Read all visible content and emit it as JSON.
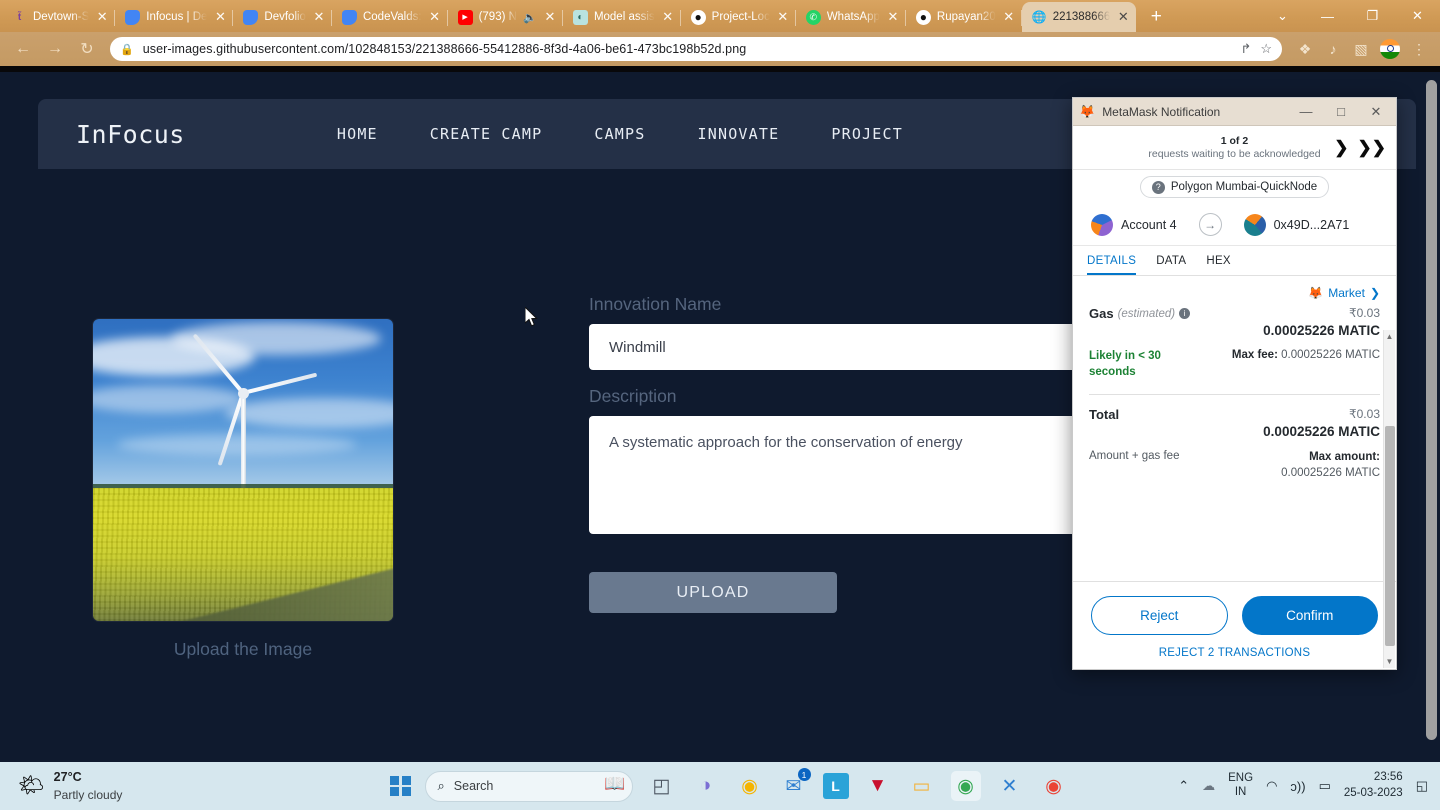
{
  "browser": {
    "tabs": [
      {
        "label": "Devtown-S",
        "icon": "todoist-icon",
        "active": false
      },
      {
        "label": "Infocus | De",
        "icon": "blue-doc-icon",
        "active": false
      },
      {
        "label": "Devfolio",
        "icon": "blue-doc-icon",
        "active": false
      },
      {
        "label": "CodeValds:",
        "icon": "blue-doc-icon",
        "active": false
      },
      {
        "label": "(793) N",
        "icon": "youtube-icon",
        "active": false,
        "muted": true
      },
      {
        "label": "Model assis",
        "icon": "spiral-icon",
        "active": false
      },
      {
        "label": "Project-Loc",
        "icon": "github-icon",
        "active": false
      },
      {
        "label": "WhatsApp",
        "icon": "whatsapp-icon",
        "active": false
      },
      {
        "label": "Rupayan20",
        "icon": "github-icon",
        "active": false
      },
      {
        "label": "221388666",
        "icon": "globe-icon",
        "active": true
      }
    ],
    "new_tab_label": "+",
    "tab_close_label": "✕",
    "window_controls": {
      "list": "⌄",
      "minimize": "—",
      "maximize": "❐",
      "close": "✕"
    },
    "toolbar": {
      "back": "←",
      "forward": "→",
      "reload": "↻",
      "lock_icon": "lock-icon",
      "url": "user-images.githubusercontent.com/102848153/221388666-55412886-8f3d-4a06-be61-473bc198b52d.png",
      "share_icon": "↱",
      "bookmark_icon": "☆",
      "extensions_icon": "❖",
      "reading_list_icon": "♪",
      "side_panel_icon": "▧",
      "profile_icon": "profile-avatar-india",
      "menu_icon": "⋮"
    }
  },
  "site": {
    "brand": "InFocus",
    "nav": [
      "HOME",
      "CREATE CAMP",
      "CAMPS",
      "INNOVATE",
      "PROJECT"
    ],
    "image_caption": "Upload the Image",
    "form": {
      "name_label": "Innovation Name",
      "name_value": "Windmill",
      "description_label": "Description",
      "description_value": "A systematic approach for the conservation of energy",
      "upload_button": "UPLOAD"
    }
  },
  "metamask": {
    "window_title": "MetaMask Notification",
    "titlebar": {
      "minimize": "—",
      "maximize": "□",
      "close": "✕"
    },
    "requests_count": "1 of 2",
    "requests_text": "requests waiting to be acknowledged",
    "next_arrow": "❯",
    "last_arrow": "❯❯",
    "network": "Polygon Mumbai-QuickNode",
    "network_help": "?",
    "from_account": "Account 4",
    "to_account": "0x49D...2A71",
    "transfer_arrow": "→",
    "tabs": [
      "DETAILS",
      "DATA",
      "HEX"
    ],
    "active_tab": "DETAILS",
    "market_label": "Market",
    "market_chevron": "❯",
    "gas_label": "Gas",
    "gas_estimated": "(estimated)",
    "gas_info": "i",
    "gas_fiat": "₹0.03",
    "gas_amount": "0.00025226 MATIC",
    "likely_text": "Likely in < 30 seconds",
    "max_fee_label": "Max fee:",
    "max_fee_value": "0.00025226 MATIC",
    "total_label": "Total",
    "total_fiat": "₹0.03",
    "total_amount": "0.00025226 MATIC",
    "amount_gas_fee_label": "Amount + gas fee",
    "max_amount_label": "Max amount:",
    "max_amount_value": "0.00025226 MATIC",
    "reject_button": "Reject",
    "confirm_button": "Confirm",
    "reject_all": "REJECT 2 TRANSACTIONS"
  },
  "taskbar": {
    "weather_temp": "27°C",
    "weather_desc": "Partly cloudy",
    "weather_icon": "partly-cloudy-icon",
    "start_label": "start-button",
    "search_placeholder": "Search",
    "search_icon": "⌕",
    "apps": [
      {
        "name": "task-view-icon",
        "glyph": "◰"
      },
      {
        "name": "teams-icon",
        "glyph": "◑"
      },
      {
        "name": "chrome-icon",
        "glyph": "◉"
      },
      {
        "name": "mail-icon",
        "glyph": "✉",
        "badge": "1"
      },
      {
        "name": "lenovo-icon",
        "glyph": "L"
      },
      {
        "name": "mcafee-icon",
        "glyph": "▼"
      },
      {
        "name": "file-explorer-icon",
        "glyph": "▭"
      },
      {
        "name": "chrome-active-icon",
        "glyph": "◉"
      },
      {
        "name": "vscode-icon",
        "glyph": "✕"
      },
      {
        "name": "chrome-icon-2",
        "glyph": "◉"
      }
    ],
    "tray": {
      "chevron": "⌃",
      "onedrive_icon": "☁",
      "lang_line1": "ENG",
      "lang_line2": "IN",
      "wifi_icon": "◠",
      "volume_icon": "ᴐ))",
      "battery_icon": "▭",
      "time": "23:56",
      "date": "25-03-2023",
      "notification_icon": "◱"
    }
  }
}
